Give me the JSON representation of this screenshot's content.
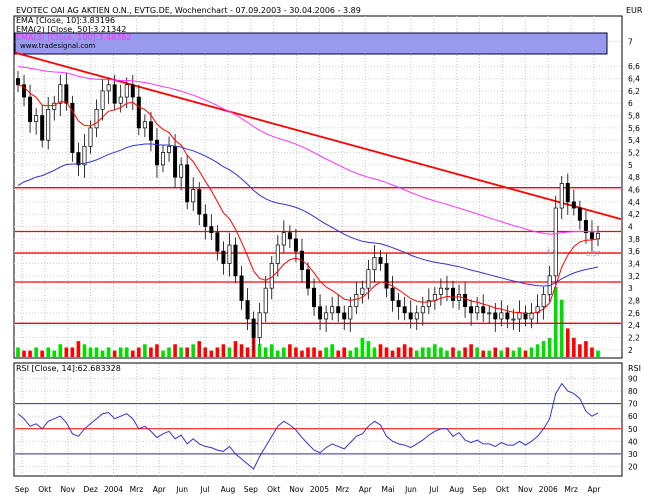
{
  "header": {
    "title_line": "EVOTEC OAI AG AKTIEN O.N., EVTG.DE, Wochenchart - 07.09.2003 - 30.04.2006 - 3.89",
    "currency": "EUR",
    "rsi_axis_label": "RSI",
    "watermark": "www.tradesignal.com"
  },
  "legend": [
    {
      "label": "EMA [Close, 10]:3.83196",
      "color": "#ff0000"
    },
    {
      "label": "EMA(2) [Close, 50]:3.21342",
      "color": "#3333cc"
    },
    {
      "label": "EMA(3) [Close, 100]:3.48362",
      "color": "#ff33ff"
    }
  ],
  "rsi_legend": {
    "label": "RSI [Close, 14]:62.683328",
    "color": "#3333cc"
  },
  "chart_data": [
    {
      "type": "line",
      "name": "price-panel",
      "ylim": [
        1.9,
        7.35
      ],
      "y_ticks": [
        2,
        2.2,
        2.4,
        2.6,
        2.8,
        3,
        3.2,
        3.4,
        3.6,
        3.8,
        4,
        4.2,
        4.4,
        4.6,
        4.8,
        5,
        5.2,
        5.4,
        5.6,
        5.8,
        6,
        6.2,
        6.4,
        6.6,
        7
      ],
      "y_tick_labels": [
        "2",
        "2,2",
        "2,4",
        "2,6",
        "2,8",
        "3",
        "3,2",
        "3,4",
        "3,6",
        "3,8",
        "4",
        "4,2",
        "4,4",
        "4,6",
        "4,8",
        "5",
        "5,2",
        "5,4",
        "5,6",
        "5,8",
        "6",
        "6,2",
        "6,4",
        "6,6",
        "7"
      ],
      "x_labels": [
        "Sep",
        "Okt",
        "Nov",
        "Dez",
        "2004",
        "Mrz",
        "Apr",
        "Jun",
        "Jul",
        "Aug",
        "Sep",
        "Okt",
        "Nov",
        "2005",
        "Mrz",
        "Apr",
        "Mai",
        "Jun",
        "Jul",
        "Aug",
        "Sep",
        "Okt",
        "Nov",
        "2006",
        "Mrz",
        "Apr"
      ],
      "price_close": [
        6.3,
        6.1,
        5.7,
        5.8,
        5.4,
        5.9,
        6.0,
        6.3,
        6.0,
        5.2,
        5.0,
        5.3,
        5.6,
        5.9,
        6.2,
        6.3,
        6.0,
        6.1,
        6.3,
        6.1,
        5.6,
        5.7,
        5.4,
        5.0,
        5.2,
        5.3,
        4.8,
        5.0,
        4.4,
        4.6,
        4.2,
        4.0,
        3.9,
        3.6,
        3.4,
        3.7,
        3.2,
        2.8,
        2.5,
        2.2,
        2.6,
        3.0,
        3.4,
        3.7,
        3.9,
        3.8,
        3.6,
        3.3,
        3.0,
        2.7,
        2.5,
        2.6,
        2.7,
        2.6,
        2.5,
        2.7,
        2.9,
        3.0,
        3.3,
        3.5,
        3.4,
        3.0,
        2.8,
        2.7,
        2.6,
        2.5,
        2.6,
        2.7,
        2.8,
        2.9,
        3.0,
        3.0,
        2.8,
        2.9,
        2.7,
        2.6,
        2.7,
        2.6,
        2.6,
        2.5,
        2.6,
        2.5,
        2.5,
        2.6,
        2.5,
        2.6,
        2.7,
        2.9,
        3.2,
        4.3,
        4.7,
        4.4,
        4.3,
        4.1,
        3.9,
        3.8,
        3.89
      ],
      "ema10_final": 3.83196,
      "ema50_final": 3.21342,
      "ema100_final": 3.48362,
      "volume": [
        3,
        2,
        2,
        3,
        2,
        3,
        2,
        4,
        3,
        3,
        5,
        4,
        3,
        3,
        2,
        3,
        2,
        3,
        3,
        2,
        3,
        4,
        3,
        4,
        2,
        3,
        4,
        3,
        3,
        4,
        5,
        3,
        2,
        3,
        4,
        3,
        5,
        4,
        3,
        6,
        4,
        3,
        4,
        2,
        3,
        4,
        3,
        2,
        3,
        3,
        2,
        3,
        4,
        2,
        3,
        2,
        3,
        6,
        5,
        3,
        4,
        3,
        2,
        3,
        4,
        3,
        2,
        3,
        3,
        4,
        3,
        2,
        3,
        2,
        3,
        4,
        3,
        2,
        2,
        3,
        2,
        3,
        2,
        3,
        2,
        3,
        4,
        5,
        6,
        22,
        18,
        9,
        6,
        4,
        5,
        3,
        2
      ],
      "horizontal_levels": [
        4.63,
        3.92,
        3.57,
        3.1,
        2.43
      ],
      "trendline": {
        "start": 6.82,
        "end": 4.12
      },
      "annotations": [
        "3,6",
        "3,57"
      ]
    },
    {
      "type": "line",
      "name": "rsi-panel",
      "ylim": [
        14,
        100
      ],
      "y_ticks": [
        20,
        30,
        40,
        50,
        60,
        70,
        80,
        90
      ],
      "y_tick_labels": [
        "20",
        "30",
        "40",
        "50",
        "60",
        "70",
        "80",
        "90"
      ],
      "reference_levels": [
        70,
        50,
        30
      ],
      "rsi_values": [
        62,
        58,
        52,
        54,
        50,
        56,
        58,
        60,
        55,
        46,
        44,
        50,
        54,
        58,
        62,
        63,
        58,
        60,
        62,
        58,
        50,
        52,
        48,
        43,
        46,
        48,
        42,
        45,
        38,
        42,
        38,
        36,
        35,
        33,
        32,
        36,
        30,
        26,
        22,
        18,
        28,
        36,
        44,
        52,
        56,
        53,
        49,
        43,
        38,
        33,
        31,
        35,
        38,
        36,
        34,
        39,
        44,
        46,
        52,
        56,
        53,
        44,
        40,
        38,
        37,
        35,
        38,
        41,
        45,
        48,
        50,
        50,
        44,
        47,
        41,
        39,
        41,
        38,
        38,
        36,
        39,
        37,
        37,
        40,
        37,
        40,
        44,
        50,
        58,
        78,
        86,
        80,
        78,
        74,
        64,
        60,
        62.68
      ]
    }
  ]
}
